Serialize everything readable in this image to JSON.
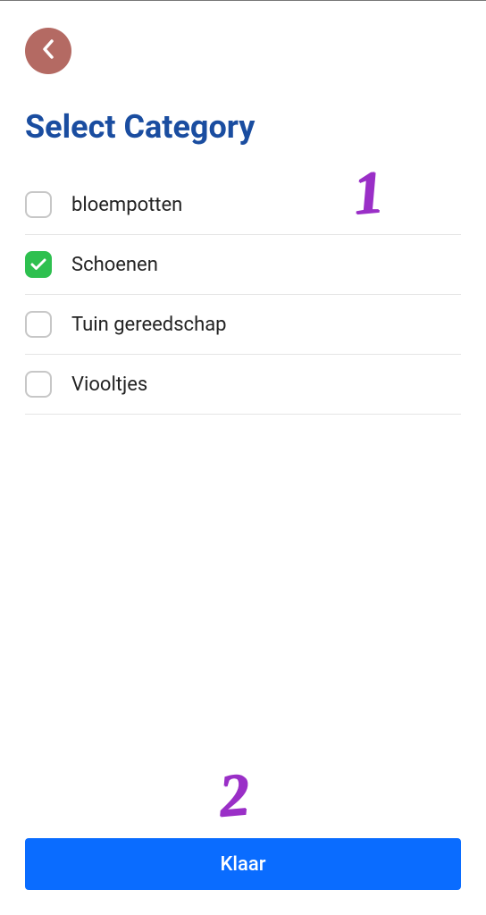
{
  "header": {
    "title": "Select Category"
  },
  "categories": [
    {
      "label": "bloempotten",
      "checked": false
    },
    {
      "label": "Schoenen",
      "checked": true
    },
    {
      "label": "Tuin gereedschap",
      "checked": false
    },
    {
      "label": "Viooltjes",
      "checked": false
    }
  ],
  "footer": {
    "done_label": "Klaar"
  },
  "annotations": {
    "one": "1",
    "two": "2"
  },
  "colors": {
    "accent": "#0a6cff",
    "title": "#1a4da0",
    "checkbox_checked": "#2ec04f",
    "back_button": "#b46a63",
    "annotation": "#9a2fc7"
  }
}
